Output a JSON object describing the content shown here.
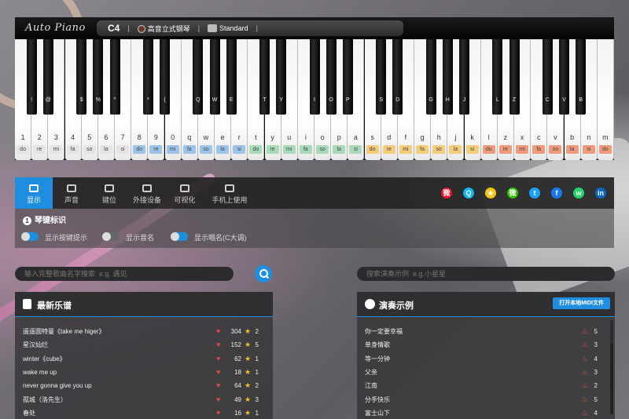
{
  "piano": {
    "logo": "Auto Piano",
    "note": "C4",
    "instrument": "高音立式钢琴",
    "mode": "Standard",
    "white_keys": [
      {
        "k": "1",
        "s": "do",
        "c": "#e5e5e5"
      },
      {
        "k": "2",
        "s": "re",
        "c": "#e5e5e5"
      },
      {
        "k": "3",
        "s": "mi",
        "c": "#e5e5e5"
      },
      {
        "k": "4",
        "s": "fa",
        "c": "#e5e5e5"
      },
      {
        "k": "5",
        "s": "so",
        "c": "#e5e5e5"
      },
      {
        "k": "6",
        "s": "la",
        "c": "#e5e5e5"
      },
      {
        "k": "7",
        "s": "si",
        "c": "#e5e5e5"
      },
      {
        "k": "8",
        "s": "do",
        "c": "#9cc4e8"
      },
      {
        "k": "9",
        "s": "re",
        "c": "#9cc4e8"
      },
      {
        "k": "0",
        "s": "mi",
        "c": "#9cc4e8"
      },
      {
        "k": "q",
        "s": "fa",
        "c": "#9cc4e8"
      },
      {
        "k": "w",
        "s": "so",
        "c": "#9cc4e8"
      },
      {
        "k": "e",
        "s": "la",
        "c": "#9cc4e8"
      },
      {
        "k": "r",
        "s": "si",
        "c": "#9cc4e8"
      },
      {
        "k": "t",
        "s": "do",
        "c": "#a9dbb8"
      },
      {
        "k": "y",
        "s": "re",
        "c": "#a9dbb8"
      },
      {
        "k": "u",
        "s": "mi",
        "c": "#a9dbb8"
      },
      {
        "k": "i",
        "s": "fa",
        "c": "#a9dbb8"
      },
      {
        "k": "o",
        "s": "so",
        "c": "#a9dbb8"
      },
      {
        "k": "p",
        "s": "la",
        "c": "#a9dbb8"
      },
      {
        "k": "a",
        "s": "si",
        "c": "#a9dbb8"
      },
      {
        "k": "s",
        "s": "do",
        "c": "#f5cc7a"
      },
      {
        "k": "d",
        "s": "re",
        "c": "#f5cc7a"
      },
      {
        "k": "f",
        "s": "mi",
        "c": "#f5cc7a"
      },
      {
        "k": "g",
        "s": "fa",
        "c": "#f5cc7a"
      },
      {
        "k": "h",
        "s": "so",
        "c": "#f5cc7a"
      },
      {
        "k": "j",
        "s": "la",
        "c": "#f5cc7a"
      },
      {
        "k": "k",
        "s": "si",
        "c": "#f5cc7a"
      },
      {
        "k": "l",
        "s": "do",
        "c": "#ef9a7a"
      },
      {
        "k": "z",
        "s": "re",
        "c": "#ef9a7a"
      },
      {
        "k": "x",
        "s": "mi",
        "c": "#ef9a7a"
      },
      {
        "k": "c",
        "s": "fa",
        "c": "#ef9a7a"
      },
      {
        "k": "v",
        "s": "so",
        "c": "#ef9a7a"
      },
      {
        "k": "b",
        "s": "la",
        "c": "#ef9a7a"
      },
      {
        "k": "n",
        "s": "si",
        "c": "#ef9a7a"
      },
      {
        "k": "m",
        "s": "do",
        "c": "#ef9a7a"
      }
    ],
    "black_keys": [
      {
        "i": 0,
        "k": "!"
      },
      {
        "i": 1,
        "k": "@"
      },
      {
        "i": 3,
        "k": "$"
      },
      {
        "i": 4,
        "k": "%"
      },
      {
        "i": 5,
        "k": "^"
      },
      {
        "i": 7,
        "k": "*"
      },
      {
        "i": 8,
        "k": "("
      },
      {
        "i": 10,
        "k": "Q"
      },
      {
        "i": 11,
        "k": "W"
      },
      {
        "i": 12,
        "k": "E"
      },
      {
        "i": 14,
        "k": "T"
      },
      {
        "i": 15,
        "k": "Y"
      },
      {
        "i": 17,
        "k": "I"
      },
      {
        "i": 18,
        "k": "O"
      },
      {
        "i": 19,
        "k": "P"
      },
      {
        "i": 21,
        "k": "S"
      },
      {
        "i": 22,
        "k": "D"
      },
      {
        "i": 24,
        "k": "G"
      },
      {
        "i": 25,
        "k": "H"
      },
      {
        "i": 26,
        "k": "J"
      },
      {
        "i": 28,
        "k": "L"
      },
      {
        "i": 29,
        "k": "Z"
      },
      {
        "i": 31,
        "k": "C"
      },
      {
        "i": 32,
        "k": "V"
      },
      {
        "i": 33,
        "k": "B"
      }
    ]
  },
  "toolbar": {
    "tabs": [
      "显示",
      "声音",
      "键位",
      "外接设备",
      "可视化",
      "手机上使用"
    ],
    "share": [
      {
        "name": "weibo-icon",
        "color": "#e6162d",
        "glyph": "微"
      },
      {
        "name": "qq-icon",
        "color": "#12b7f5",
        "glyph": "Q"
      },
      {
        "name": "star-icon",
        "color": "#f5c518",
        "glyph": "★"
      },
      {
        "name": "wechat-icon",
        "color": "#2dc100",
        "glyph": "微"
      },
      {
        "name": "twitter-icon",
        "color": "#1da1f2",
        "glyph": "t"
      },
      {
        "name": "facebook-icon",
        "color": "#1877f2",
        "glyph": "f"
      },
      {
        "name": "whatsapp-icon",
        "color": "#25d366",
        "glyph": "w"
      },
      {
        "name": "linkedin-icon",
        "color": "#0a66c2",
        "glyph": "in"
      }
    ]
  },
  "settings": {
    "number": "1",
    "title": "琴键标识",
    "toggles": [
      {
        "label": "显示按键提示",
        "on": true
      },
      {
        "label": "显示音名",
        "on": false
      },
      {
        "label": "显示唱名(C大调)",
        "on": true
      }
    ]
  },
  "search": {
    "left_placeholder": "输入完整歌曲名字搜索  e.g. 遇见",
    "right_placeholder": "搜索演奏示例  e.g.小星星"
  },
  "sheets": {
    "title": "最新乐谱",
    "rows": [
      {
        "name": "遥遥圆特曼《take me higer》",
        "likes": "304",
        "stars": "2"
      },
      {
        "name": "星汉灿烂",
        "likes": "152",
        "stars": "5"
      },
      {
        "name": "winter《cube》",
        "likes": "62",
        "stars": "1"
      },
      {
        "name": "wake me up",
        "likes": "18",
        "stars": "1"
      },
      {
        "name": "never gonna give you up",
        "likes": "64",
        "stars": "2"
      },
      {
        "name": "孤城（洛先生）",
        "likes": "49",
        "stars": "3"
      },
      {
        "name": "春处",
        "likes": "16",
        "stars": "1"
      }
    ]
  },
  "demos": {
    "title": "演奏示例",
    "open_button": "打开本地MIDI文件",
    "rows": [
      {
        "name": "你一定要幸福",
        "score": "5"
      },
      {
        "name": "单身情歌",
        "score": "3"
      },
      {
        "name": "等一分钟",
        "score": "4"
      },
      {
        "name": "父亲",
        "score": "3"
      },
      {
        "name": "江南",
        "score": "2"
      },
      {
        "name": "分手快乐",
        "score": "5"
      },
      {
        "name": "富士山下",
        "score": "4"
      }
    ]
  }
}
